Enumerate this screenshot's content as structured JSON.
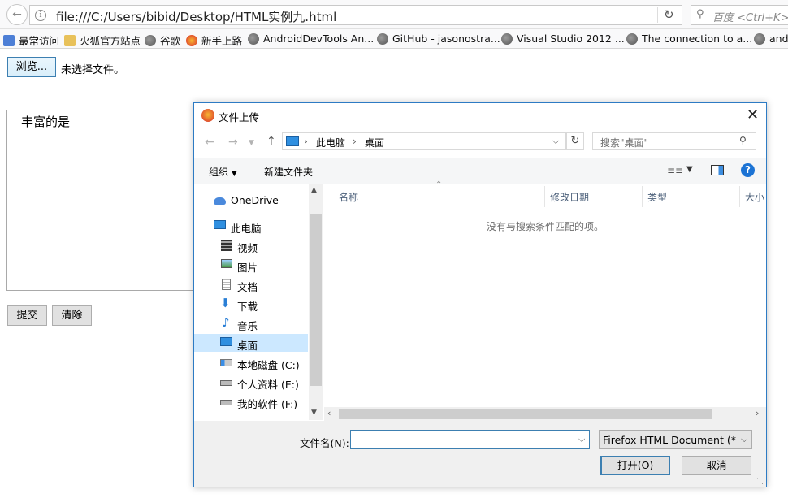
{
  "browser": {
    "url": "file:///C:/Users/bibid/Desktop/HTML实例九.html",
    "search_placeholder": "百度 <Ctrl+K>",
    "bookmarks": [
      {
        "label": "最常访问",
        "icon": "star-icon"
      },
      {
        "label": "火狐官方站点",
        "icon": "folder-icon"
      },
      {
        "label": "谷歌",
        "icon": "globe-icon"
      },
      {
        "label": "新手上路",
        "icon": "firefox-icon"
      },
      {
        "label": "AndroidDevTools An...",
        "icon": "globe-icon"
      },
      {
        "label": "GitHub - jasonostra...",
        "icon": "globe-icon"
      },
      {
        "label": "Visual Studio 2012 ...",
        "icon": "globe-icon"
      },
      {
        "label": "The connection to a...",
        "icon": "globe-icon"
      },
      {
        "label": "and",
        "icon": "globe-icon"
      }
    ]
  },
  "page": {
    "browse_label": "浏览...",
    "no_file_label": "未选择文件。",
    "textarea_text": "丰富的是",
    "submit_label": "提交",
    "clear_label": "清除"
  },
  "dialog": {
    "title": "文件上传",
    "breadcrumb": [
      "此电脑",
      "桌面"
    ],
    "search_placeholder": "搜索\"桌面\"",
    "toolbar": {
      "organize": "组织",
      "new_folder": "新建文件夹"
    },
    "nav_items": [
      {
        "label": "OneDrive",
        "icon": "onedrive-icon",
        "indent": false,
        "selected": false
      },
      {
        "label": "此电脑",
        "icon": "computer-icon",
        "indent": false,
        "selected": false
      },
      {
        "label": "视频",
        "icon": "video-icon",
        "indent": true,
        "selected": false
      },
      {
        "label": "图片",
        "icon": "pictures-icon",
        "indent": true,
        "selected": false
      },
      {
        "label": "文档",
        "icon": "documents-icon",
        "indent": true,
        "selected": false
      },
      {
        "label": "下载",
        "icon": "download-icon",
        "indent": true,
        "selected": false
      },
      {
        "label": "音乐",
        "icon": "music-icon",
        "indent": true,
        "selected": false
      },
      {
        "label": "桌面",
        "icon": "desktop-icon",
        "indent": true,
        "selected": true
      },
      {
        "label": "本地磁盘 (C:)",
        "icon": "drive-icon",
        "indent": true,
        "selected": false
      },
      {
        "label": "个人资料 (E:)",
        "icon": "drive-icon",
        "indent": true,
        "selected": false
      },
      {
        "label": "我的软件 (F:)",
        "icon": "drive-icon",
        "indent": true,
        "selected": false
      }
    ],
    "columns": {
      "name": "名称",
      "modified": "修改日期",
      "type": "类型",
      "size": "大小"
    },
    "empty_message": "没有与搜索条件匹配的项。",
    "filename_label": "文件名(N):",
    "filename_value": "",
    "filetype": "Firefox HTML Document (*.htm;*.html)",
    "open_label": "打开(O)",
    "cancel_label": "取消"
  }
}
